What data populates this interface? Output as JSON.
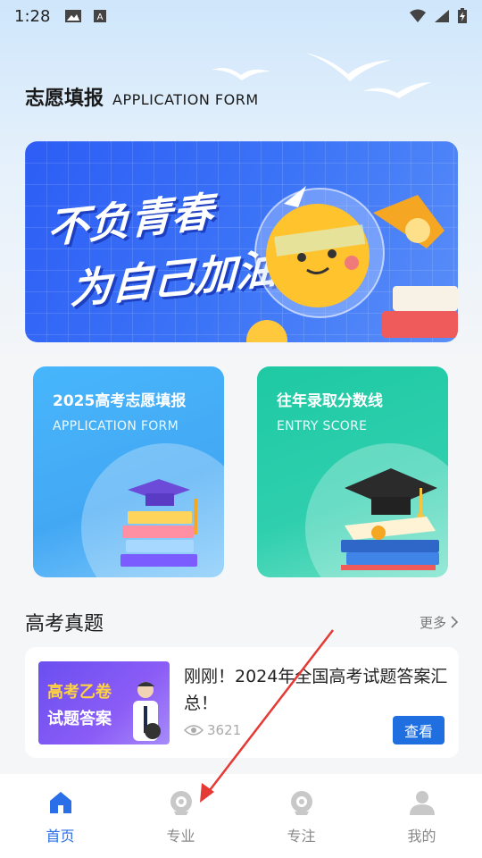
{
  "status_bar": {
    "time": "1:28"
  },
  "header": {
    "title": "志愿填报",
    "subtitle": "APPLICATION FORM"
  },
  "banner": {
    "line1": "不负青春",
    "line2": "为自己加油"
  },
  "cards": [
    {
      "title": "2025高考志愿填报",
      "subtitle": "APPLICATION FORM"
    },
    {
      "title": "往年录取分数线",
      "subtitle": "ENTRY SCORE"
    }
  ],
  "exam_section": {
    "title": "高考真题",
    "more_label": "更多"
  },
  "article": {
    "thumb_line1": "高考乙卷",
    "thumb_line2": "试题答案",
    "title": "刚刚！2024年全国高考试题答案汇总！",
    "views": "3621",
    "button_label": "查看"
  },
  "bottom_nav": {
    "items": [
      {
        "label": "首页",
        "active": true,
        "icon": "home-icon"
      },
      {
        "label": "专业",
        "active": false,
        "icon": "major-icon"
      },
      {
        "label": "专注",
        "active": false,
        "icon": "focus-icon"
      },
      {
        "label": "我的",
        "active": false,
        "icon": "profile-icon"
      }
    ]
  },
  "colors": {
    "accent": "#1f6fe0",
    "nav_active": "#2a6fe8",
    "annotation_arrow": "#e53935"
  }
}
